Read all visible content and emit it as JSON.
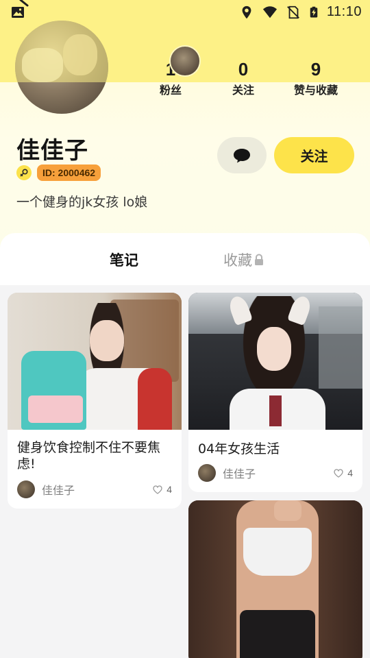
{
  "status": {
    "time": "11:10"
  },
  "profile": {
    "name": "佳佳子",
    "id_label": "ID: 2000462",
    "bio": "一个健身的jk女孩 lo娘",
    "stats": [
      {
        "num": "1",
        "label": "粉丝"
      },
      {
        "num": "0",
        "label": "关注"
      },
      {
        "num": "9",
        "label": "赞与收藏"
      }
    ],
    "follow_label": "关注"
  },
  "tabs": [
    {
      "label": "笔记",
      "active": true
    },
    {
      "label": "收藏",
      "active": false,
      "locked": true
    }
  ],
  "notes": [
    {
      "title": "健身饮食控制不住不要焦虑!",
      "author": "佳佳子",
      "likes": "4"
    },
    {
      "title": "04年女孩生活",
      "author": "佳佳子",
      "likes": "4"
    },
    {
      "title": "",
      "author": "",
      "likes": ""
    }
  ],
  "icons": {
    "gallery": "image-icon",
    "location": "location-icon",
    "wifi": "wifi-icon",
    "no_sim": "no-sim-icon",
    "battery": "battery-charging-icon",
    "message": "chat-bubble-icon",
    "gender": "female-icon",
    "lock": "lock-icon",
    "heart": "heart-outline-icon"
  },
  "colors": {
    "accent": "#fde34a",
    "id_tag": "#f7a03b",
    "hero_top": "#fdf187"
  }
}
